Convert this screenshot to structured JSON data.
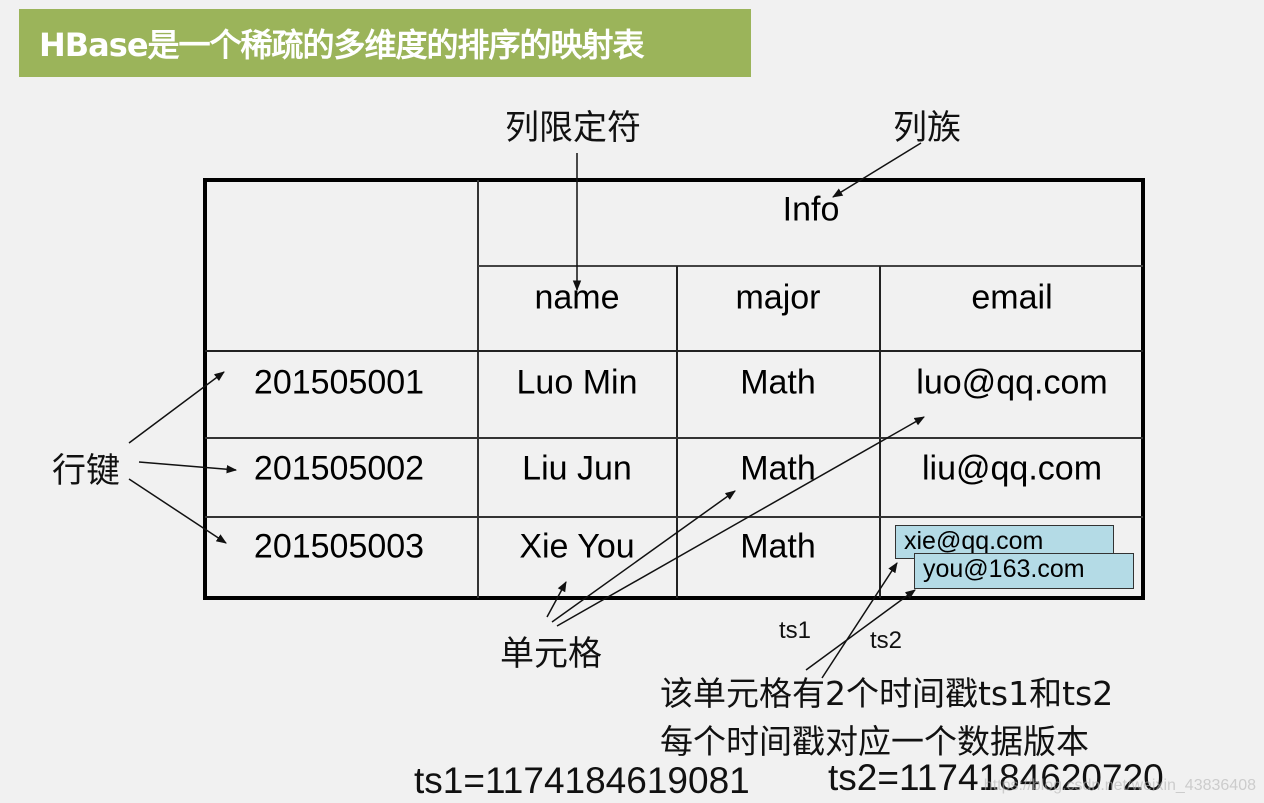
{
  "title": "HBase是一个稀疏的多维度的排序的映射表",
  "labels": {
    "column_qualifier": "列限定符",
    "column_family": "列族",
    "row_key": "行键",
    "cell": "单元格",
    "ts1": "ts1",
    "ts2": "ts2"
  },
  "table": {
    "column_family": "Info",
    "columns": [
      "name",
      "major",
      "email"
    ],
    "rows": [
      {
        "row_key": "201505001",
        "name": "Luo Min",
        "major": "Math",
        "email": "luo@qq.com"
      },
      {
        "row_key": "201505002",
        "name": "Liu Jun",
        "major": "Math",
        "email": "liu@qq.com"
      },
      {
        "row_key": "201505003",
        "name": "Xie You",
        "major": "Math",
        "email_versions": [
          "xie@qq.com",
          "you@163.com"
        ]
      }
    ]
  },
  "notes": {
    "line1": "该单元格有2个时间戳ts1和ts2",
    "line2": "每个时间戳对应一个数据版本",
    "ts1_value": "ts1=1174184619081",
    "ts2_value": "ts2=1174184620720"
  },
  "watermark": "https://blog.csdn.net/weixin_43836408",
  "colors": {
    "title_bg": "#9bb45a",
    "version_box_bg": "#b4dbe6",
    "background": "#f1f1f1"
  }
}
